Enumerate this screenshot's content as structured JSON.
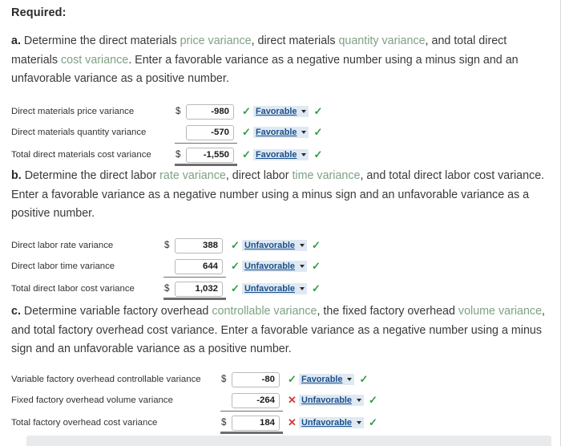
{
  "heading": "Required:",
  "parts": {
    "a": {
      "letter": "a.",
      "t1": " Determine the direct materials ",
      "term1": "price variance",
      "t2": ", direct materials ",
      "term2": "quantity variance",
      "t3": ", and total direct materials ",
      "term3": "cost variance",
      "t4": ". Enter a favorable variance as a negative number using a minus sign and an unfavorable variance as a positive number.",
      "rows": [
        {
          "label": "Direct materials price variance",
          "currency": "$",
          "value": "-980",
          "mark": "✓",
          "mark_state": "ok",
          "select": "Favorable",
          "trailing": "✓",
          "trailing_state": "ok"
        },
        {
          "label": "Direct materials quantity variance",
          "currency": "",
          "value": "-570",
          "mark": "✓",
          "mark_state": "ok",
          "select": "Favorable",
          "trailing": "✓",
          "trailing_state": "ok"
        },
        {
          "label": "Total direct materials cost variance",
          "currency": "$",
          "value": "-1,550",
          "mark": "✓",
          "mark_state": "ok",
          "select": "Favorable",
          "trailing": "✓",
          "trailing_state": "ok"
        }
      ]
    },
    "b": {
      "letter": "b.",
      "t1": " Determine the direct labor ",
      "term1": "rate variance",
      "t2": ", direct labor ",
      "term2": "time variance",
      "t3": ", and total direct labor cost variance. Enter a favorable variance as a negative number using a minus sign and an unfavorable variance as a positive number.",
      "rows": [
        {
          "label": "Direct labor rate variance",
          "currency": "$",
          "value": "388",
          "mark": "✓",
          "mark_state": "ok",
          "select": "Unfavorable",
          "trailing": "✓",
          "trailing_state": "ok"
        },
        {
          "label": "Direct labor time variance",
          "currency": "",
          "value": "644",
          "mark": "✓",
          "mark_state": "ok",
          "select": "Unfavorable",
          "trailing": "✓",
          "trailing_state": "ok"
        },
        {
          "label": "Total direct labor cost variance",
          "currency": "$",
          "value": "1,032",
          "mark": "✓",
          "mark_state": "ok",
          "select": "Unfavorable",
          "trailing": "✓",
          "trailing_state": "ok"
        }
      ]
    },
    "c": {
      "letter": "c.",
      "t1": " Determine variable factory overhead ",
      "term1": "controllable variance",
      "t2": ", the fixed factory overhead ",
      "term2": "volume variance",
      "t3": ", and total factory overhead cost variance. Enter a favorable variance as a negative number using a minus sign and an unfavorable variance as a positive number.",
      "rows": [
        {
          "label": "Variable factory overhead controllable variance",
          "currency": "$",
          "value": "-80",
          "mark": "✓",
          "mark_state": "ok",
          "select": "Favorable",
          "trailing": "✓",
          "trailing_state": "ok"
        },
        {
          "label": "Fixed factory overhead volume variance",
          "currency": "",
          "value": "-264",
          "mark": "✕",
          "mark_state": "bad",
          "select": "Unfavorable",
          "trailing": "✓",
          "trailing_state": "ok"
        },
        {
          "label": "Total factory overhead cost variance",
          "currency": "$",
          "value": "184",
          "mark": "✕",
          "mark_state": "bad",
          "select": "Unfavorable",
          "trailing": "✓",
          "trailing_state": "ok"
        }
      ]
    }
  },
  "colors": {
    "term_green": "#7fa184",
    "link_blue": "#1a4f8a",
    "check_green": "#2f9e41",
    "cross_red": "#d33a33"
  }
}
